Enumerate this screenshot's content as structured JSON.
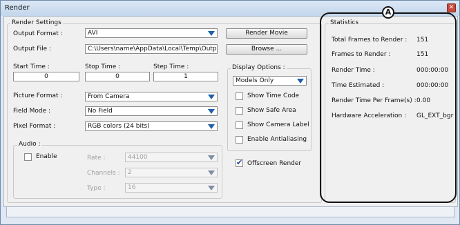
{
  "window": {
    "title": "Render",
    "close_glyph": "✕"
  },
  "render_settings": {
    "group_label": "Render Settings",
    "output_format": {
      "label": "Output Format :",
      "value": "AVI"
    },
    "output_file": {
      "label": "Output File :",
      "value": "C:\\Users\\name\\AppData\\Local\\Temp\\Output.avi"
    },
    "render_movie_button": "Render Movie",
    "browse_button": "Browse ...",
    "start_time": {
      "label": "Start Time :",
      "value": "0"
    },
    "stop_time": {
      "label": "Stop Time :",
      "value": "0"
    },
    "step_time": {
      "label": "Step Time :",
      "value": "1"
    },
    "picture_format": {
      "label": "Picture Format :",
      "value": "From Camera"
    },
    "field_mode": {
      "label": "Field Mode :",
      "value": "No Field"
    },
    "pixel_format": {
      "label": "Pixel Format :",
      "value": "RGB colors (24 bits)"
    }
  },
  "display_options": {
    "group_label": "Display Options :",
    "mode": "Models Only",
    "show_time_code": {
      "label": "Show Time Code",
      "checked": false
    },
    "show_safe_area": {
      "label": "Show Safe Area",
      "checked": false
    },
    "show_camera_label": {
      "label": "Show Camera Label",
      "checked": false
    },
    "enable_antialiasing": {
      "label": "Enable Antialiasing",
      "checked": false
    }
  },
  "audio": {
    "group_label": "Audio :",
    "enable": {
      "label": "Enable",
      "checked": false
    },
    "rate": {
      "label": "Rate :",
      "value": "44100"
    },
    "channels": {
      "label": "Channels :",
      "value": "2"
    },
    "type": {
      "label": "Type :",
      "value": "16"
    }
  },
  "offscreen_render": {
    "label": "Offscreen Render",
    "checked": true,
    "check_glyph": "✔"
  },
  "statistics": {
    "group_label": "Statistics",
    "total_frames": {
      "label": "Total Frames to Render :",
      "value": "151"
    },
    "frames_to_render": {
      "label": "Frames to Render :",
      "value": "151"
    },
    "render_time": {
      "label": "Render Time :",
      "value": "000:00:00"
    },
    "time_estimated": {
      "label": "Time Estimated :",
      "value": "000:00:00"
    },
    "render_time_per_frame": {
      "label": "Render Time Per Frame(s) :",
      "value": "0.00"
    },
    "hardware_acceleration": {
      "label": "Hardware Acceleration :",
      "value": "GL_EXT_bgr"
    }
  },
  "callout": {
    "text": "A"
  }
}
